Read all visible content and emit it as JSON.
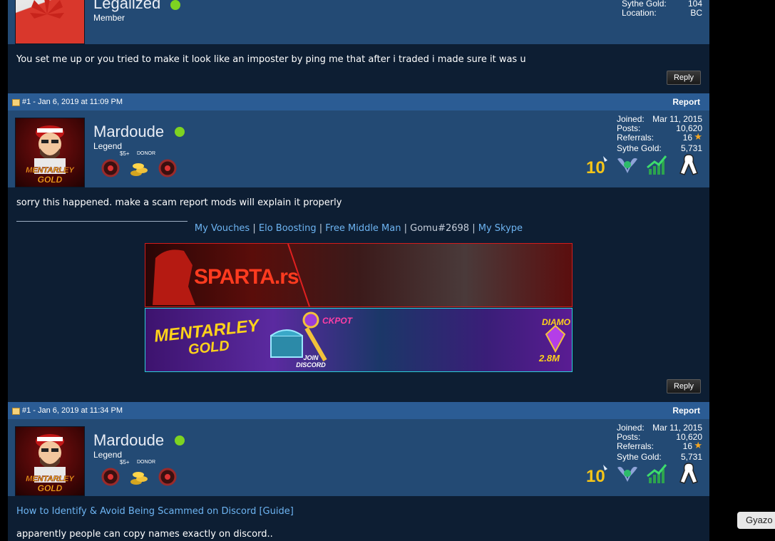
{
  "post0": {
    "username": "Legalized",
    "rank": "Member",
    "stats": [
      {
        "label": "Sythe Gold:",
        "value": "104"
      },
      {
        "label": "Location:",
        "value": "BC"
      }
    ],
    "message": "You set me up or you tried to make it look like an imposter by ping me that after i traded i made sure it was u",
    "reply_label": "Reply"
  },
  "post1": {
    "post_id": "#1 - Jan 6, 2019 at 11:09 PM",
    "report_label": "Report",
    "username": "Mardoude",
    "rank": "Legend",
    "badge_labels": [
      "$5+",
      "DONOR"
    ],
    "stats": [
      {
        "label": "Joined:",
        "value": "Mar 11, 2015"
      },
      {
        "label": "Posts:",
        "value": "10,620"
      },
      {
        "label": "Referrals:",
        "value": "16"
      },
      {
        "label": "Sythe Gold:",
        "value": "5,731"
      }
    ],
    "avatar_text": "MENTARLEY GOLD",
    "message": "sorry this happened. make a scam report mods will explain it properly",
    "signature": {
      "links": [
        "My Vouches",
        "Elo Boosting",
        "Free Middle Man"
      ],
      "plain": "Gomu#2698",
      "last_link": "My Skype",
      "separator": "|"
    },
    "banner1_text": "SPARTA.rs",
    "banner2": {
      "title": "MENTARLEY",
      "subtitle": "GOLD",
      "jackpot": "CKPOT",
      "discord": "JOIN DISCORD",
      "diamond": "DIAMO",
      "amount": "2.8M"
    },
    "reply_label": "Reply"
  },
  "post2": {
    "post_id": "#1 - Jan 6, 2019 at 11:34 PM",
    "report_label": "Report",
    "username": "Mardoude",
    "rank": "Legend",
    "badge_labels": [
      "$5+",
      "DONOR"
    ],
    "stats": [
      {
        "label": "Joined:",
        "value": "Mar 11, 2015"
      },
      {
        "label": "Posts:",
        "value": "10,620"
      },
      {
        "label": "Referrals:",
        "value": "16"
      },
      {
        "label": "Sythe Gold:",
        "value": "5,731"
      }
    ],
    "avatar_text": "MENTARLEY GOLD",
    "link": "How to Identify & Avoid Being Scammed on Discord [Guide]",
    "message": "apparently people can copy names exactly on discord.."
  },
  "gyazo_label": "Gyazo",
  "colors": {
    "online": "#7ed321",
    "link": "#6db4f2",
    "header": "#2b5c94",
    "userbar": "#234a74",
    "body": "#0d1e33"
  }
}
